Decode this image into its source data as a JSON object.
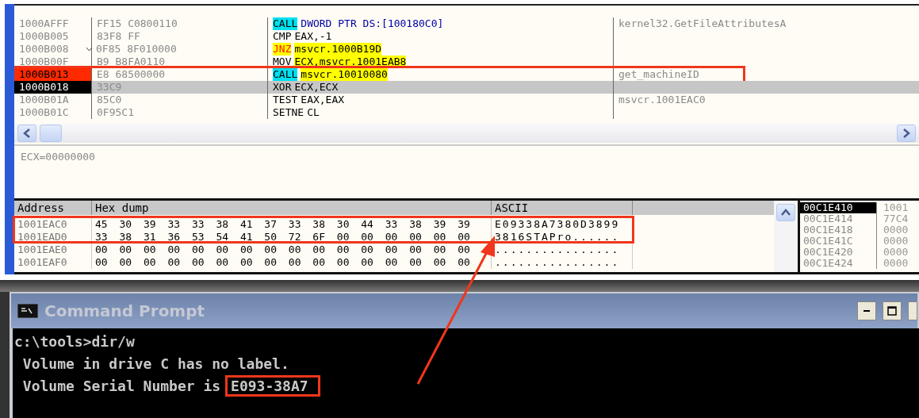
{
  "disassembly": {
    "rows": [
      {
        "address": "1000AFFF",
        "hex": "FF15 C0800110",
        "jump_mark": false,
        "mnemonic": {
          "text": "CALL",
          "kind": "call"
        },
        "operand": {
          "text": "DWORD PTR DS:[100180C0]",
          "kind": "memory"
        },
        "comment": "kernel32.GetFileAttributesA",
        "breakpoint": false,
        "selected": false,
        "highlighted": false
      },
      {
        "address": "1000B005",
        "hex": "83F8 FF",
        "jump_mark": false,
        "mnemonic": {
          "text": "CMP",
          "kind": "plain"
        },
        "operand": {
          "text": "EAX,-1",
          "kind": "plain"
        },
        "comment": "",
        "breakpoint": false,
        "selected": false,
        "highlighted": false
      },
      {
        "address": "1000B008",
        "hex": "0F85 8F010000",
        "jump_mark": true,
        "mnemonic": {
          "text": "JNZ",
          "kind": "jump"
        },
        "operand": {
          "text": "msvcr.1000B19D",
          "kind": "label"
        },
        "comment": "",
        "breakpoint": false,
        "selected": false,
        "highlighted": false
      },
      {
        "address": "1000B00F",
        "hex": "B9 B8FA0110",
        "jump_mark": false,
        "mnemonic": {
          "text": "MOV",
          "kind": "plain"
        },
        "operand": {
          "text": "ECX,msvcr.1001EAB8",
          "kind": "label"
        },
        "comment": "",
        "breakpoint": false,
        "selected": false,
        "highlighted": false
      },
      {
        "address": "1000B013",
        "hex": "E8 68500000",
        "jump_mark": false,
        "mnemonic": {
          "text": "CALL",
          "kind": "call"
        },
        "operand": {
          "text": "msvcr.10010080",
          "kind": "label"
        },
        "comment": "get_machineID",
        "breakpoint": true,
        "selected": false,
        "highlighted": true
      },
      {
        "address": "1000B018",
        "hex": "33C9",
        "jump_mark": false,
        "mnemonic": {
          "text": "XOR",
          "kind": "plain"
        },
        "operand": {
          "text": "ECX,ECX",
          "kind": "plain"
        },
        "comment": "",
        "breakpoint": false,
        "selected": true,
        "highlighted": false
      },
      {
        "address": "1000B01A",
        "hex": "85C0",
        "jump_mark": false,
        "mnemonic": {
          "text": "TEST",
          "kind": "plain"
        },
        "operand": {
          "text": "EAX,EAX",
          "kind": "plain"
        },
        "comment": "msvcr.1001EAC0",
        "breakpoint": false,
        "selected": false,
        "highlighted": false
      },
      {
        "address": "1000B01C",
        "hex": "0F95C1",
        "jump_mark": false,
        "mnemonic": {
          "text": "SETNE",
          "kind": "plain"
        },
        "operand": {
          "text": "CL",
          "kind": "plain"
        },
        "comment": "",
        "breakpoint": false,
        "selected": false,
        "highlighted": false
      }
    ]
  },
  "info": {
    "text": "ECX=00000000"
  },
  "dump": {
    "columns": [
      "Address",
      "Hex dump",
      "ASCII"
    ],
    "rows": [
      {
        "address": "1001EAC0",
        "hex": "45 30 39 33 33 38 41 37 33 38 30 44 33 38 39 39",
        "ascii": "E09338A7380D3899",
        "highlighted": true
      },
      {
        "address": "1001EAD0",
        "hex": "33 38 31 36 53 54 41 50 72 6F 00 00 00 00 00 00",
        "ascii": "3816STAPro......",
        "highlighted": true
      },
      {
        "address": "1001EAE0",
        "hex": "00 00 00 00 00 00 00 00 00 00 00 00 00 00 00 00",
        "ascii": "................",
        "highlighted": false
      },
      {
        "address": "1001EAF0",
        "hex": "00 00 00 00 00 00 00 00 00 00 00 00 00 00 00 00",
        "ascii": "................",
        "highlighted": false
      }
    ]
  },
  "stack": {
    "rows": [
      {
        "address": "00C1E410",
        "value": "1001",
        "selected": true
      },
      {
        "address": "00C1E414",
        "value": "77C4",
        "selected": false
      },
      {
        "address": "00C1E418",
        "value": "0000",
        "selected": false
      },
      {
        "address": "00C1E41C",
        "value": "0000",
        "selected": false
      },
      {
        "address": "00C1E420",
        "value": "0000",
        "selected": false
      },
      {
        "address": "00C1E424",
        "value": "0000",
        "selected": false
      }
    ]
  },
  "command_prompt": {
    "title": "Command Prompt",
    "lines": [
      {
        "text": "c:\\tools>dir/w"
      },
      {
        "text": " Volume in drive C has no label."
      },
      {
        "text": " Volume Serial Number is",
        "highlighted_value": "E093-38A7"
      }
    ]
  },
  "annotation_arrow": true
}
